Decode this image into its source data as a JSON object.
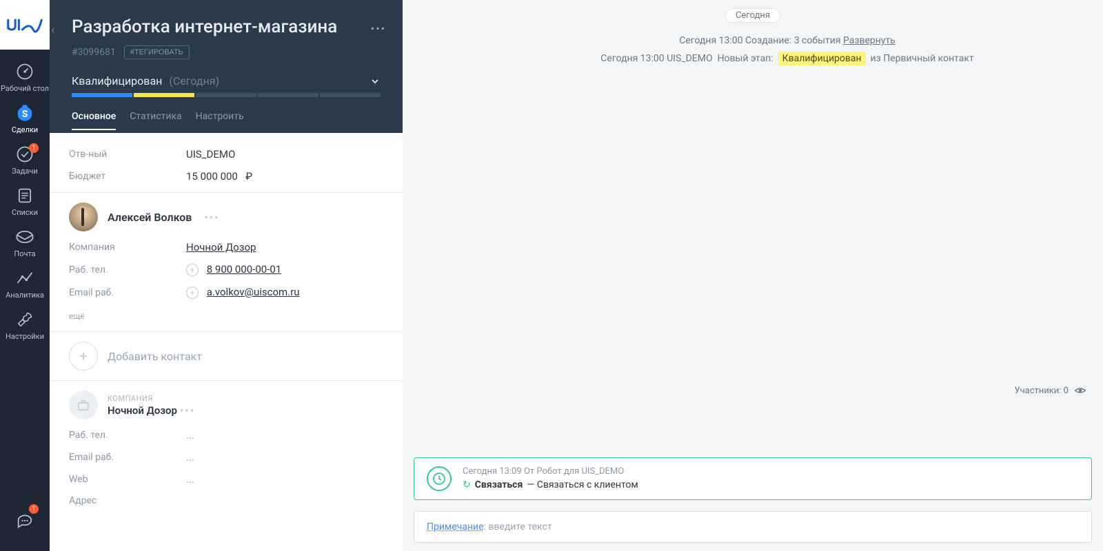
{
  "sidebar": {
    "items": [
      {
        "label": "Рабочий стол"
      },
      {
        "label": "Сделки"
      },
      {
        "label": "Задачи",
        "badge": "1"
      },
      {
        "label": "Списки"
      },
      {
        "label": "Почта"
      },
      {
        "label": "Аналитика"
      },
      {
        "label": "Настройки"
      }
    ],
    "chat_badge": "1"
  },
  "deal": {
    "title": "Разработка интернет-магазина",
    "id": "#3099681",
    "tag_button": "#ТЕГИРОВАТЬ",
    "stage": "Квалифицирован",
    "stage_date": "(Сегодня)",
    "tabs": [
      "Основное",
      "Статистика",
      "Настроить"
    ],
    "fields": {
      "responsible_label": "Отв-ный",
      "responsible_value": "UIS_DEMO",
      "budget_label": "Бюджет",
      "budget_value": "15 000 000",
      "currency": "₽"
    },
    "contact": {
      "name": "Алексей Волков",
      "company_label": "Компания",
      "company_value": "Ночной Дозор",
      "phone_label": "Раб. тел.",
      "phone_value": "8 900 000-00-01",
      "email_label": "Email раб.",
      "email_value": "a.volkov@uiscom.ru",
      "more": "ещё"
    },
    "add_contact": "Добавить контакт",
    "company_block": {
      "label": "КОМПАНИЯ",
      "name": "Ночной Дозор",
      "phone_label": "Раб. тел.",
      "phone_value": "...",
      "email_label": "Email раб.",
      "email_value": "...",
      "web_label": "Web",
      "web_value": "...",
      "addr_label": "Адрес"
    }
  },
  "feed": {
    "today_pill": "Сегодня",
    "line1_time": "Сегодня 13:00",
    "line1_text": "Создание: 3 события",
    "line1_link": "Развернуть",
    "line2_time": "Сегодня 13:00",
    "line2_user": "UIS_DEMO",
    "line2_text": "Новый этап:",
    "line2_hl": "Квалифицирован",
    "line2_suffix": "из Первичный контакт",
    "participants": "Участники: 0"
  },
  "task": {
    "meta": "Сегодня 13:09 От Робот для UIS_DEMO",
    "title": "Связаться",
    "desc": "— Связаться с клиентом"
  },
  "note": {
    "label": "Примечание",
    "placeholder": ": введите текст"
  }
}
